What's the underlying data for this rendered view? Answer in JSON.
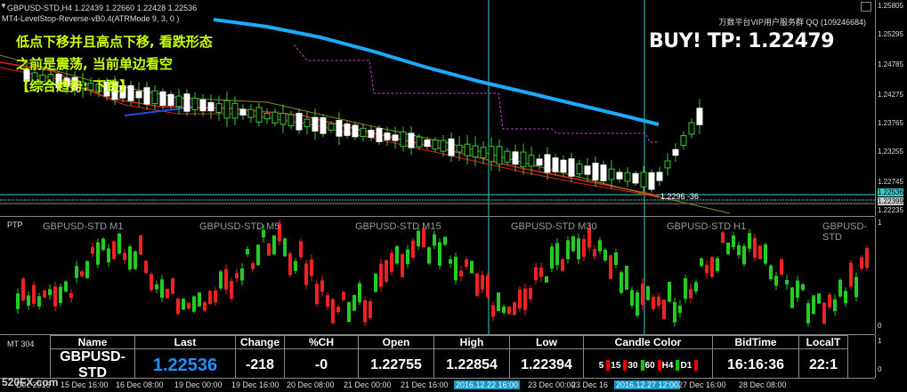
{
  "main_chart": {
    "header": "GBPUSD-STD,H4  1.22439 1.22660 1.22428 1.22536",
    "indicator": "MT4-LevelStop-Reverse-vB0.4(ATRMode 9, 3, 0 )",
    "signal": "BUY!  TP: 1.22479",
    "vendor": "万数平台VIP用户服务群 QQ (109246684)",
    "notes": [
      "低点下移并且高点下移, 看跌形态",
      "之前是震荡, 当前单边看空",
      "【综合趋势: 下跌】"
    ],
    "stop_label": "1.2296 -36",
    "price_ticks": [
      "1.25805",
      "1.25295",
      "1.24785",
      "1.24275",
      "1.23765",
      "1.23255",
      "1.22745",
      "1.22536",
      "1.22399",
      "1.22235"
    ],
    "colors": {
      "ma_blue": "#1eaaff",
      "ma_red": "#e02020",
      "band": "#c040c0"
    }
  },
  "ptp_panel": {
    "title": "PTP",
    "timeframes": [
      "GBPUSD-STD M1",
      "GBPUSD-STD M5",
      "GBPUSD-STD M15",
      "GBPUSD-STD M30",
      "GBPUSD-STD H1",
      "GBPUSD-STD"
    ],
    "axis_ticks": [
      "1",
      "0"
    ]
  },
  "info_panel": {
    "title": "MT 304",
    "headers": [
      "Name",
      "Last",
      "Change",
      "%CH",
      "Open",
      "High",
      "Low",
      "Candle Color",
      "BidTime",
      "LocalT"
    ],
    "values": [
      "GBPUSD-STD",
      "1.22536",
      "-218",
      "-0",
      "1.22755",
      "1.22854",
      "1.22394",
      "",
      "16:16:36",
      "22:1"
    ],
    "candle_color": {
      "labels": [
        "5",
        "15",
        "30",
        "60",
        "H4",
        "D1"
      ],
      "colors": [
        "#e00",
        "#e00",
        "#0c0",
        "#e00",
        "#0c0",
        "#e00"
      ]
    },
    "axis_ticks": [
      "1",
      "0"
    ]
  },
  "time_axis": {
    "labels": [
      "Dec 2016",
      "15 Dec 16:00",
      "16 Dec 08:00",
      "19 Dec 00:00",
      "19 Dec 16:00",
      "20 Dec 08:00",
      "21 Dec 00:00",
      "21 Dec 16:00",
      "2016.12.22 16:00",
      "23 Dec 00:00",
      "23 Dec 16",
      "2016.12.27 12:00",
      "27 Dec 16:00",
      "28 Dec 08:00"
    ],
    "watermark": "520FX.com"
  }
}
